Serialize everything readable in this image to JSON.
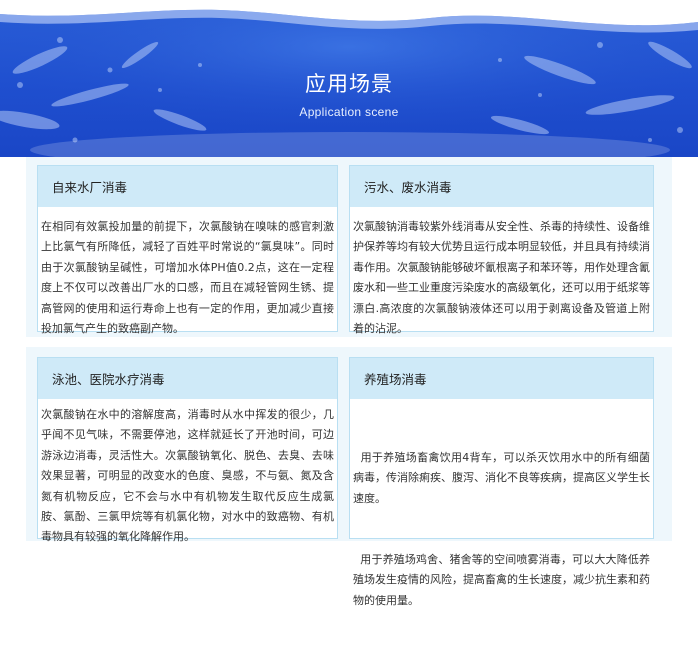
{
  "hero": {
    "title": "应用场景",
    "subtitle": "Application scene"
  },
  "colors": {
    "hero_blue": "#1f4fcf",
    "panel_header": "#cfeaf8",
    "panel_border": "#b9dff2",
    "section_bg": "#eef7fc"
  },
  "panels": [
    {
      "title": "自来水厂消毒",
      "paragraphs": [
        "在相同有效氯投加量的前提下，次氯酸钠在嗅味的感官刺激上比氯气有所降低，减轻了百姓平时常说的“氯臭味”。同时由于次氯酸钠呈碱性，可增加水体PH值0.2点，这在一定程度上不仅可以改善出厂水的口感，而且在减轻管网生锈、提高管网的使用和运行寿命上也有一定的作用，更加减少直接投加氯气产生的致癌副产物。"
      ]
    },
    {
      "title": "污水、废水消毒",
      "paragraphs": [
        "次氯酸钠消毒较紫外线消毒从安全性、杀毒的持续性、设备维护保养等均有较大优势且运行成本明显较低，并且具有持续消毒作用。次氯酸钠能够破坏氰根离子和苯环等，用作处理含氰废水和一些工业重度污染废水的高级氧化，还可以用于纸浆等漂白.高浓度的次氯酸钠液体还可以用于剥离设备及管道上附着的沾泥。"
      ]
    },
    {
      "title": "泳池、医院水疗消毒",
      "paragraphs": [
        "次氯酸钠在水中的溶解度高，消毒时从水中挥发的很少，几乎闻不见气味，不需要停池，这样就延长了开池时间，可边游泳边消毒，灵活性大。次氯酸钠氧化、脱色、去臭、去味效果显著，可明显的改变水的色度、臭感，不与氨、氮及含氮有机物反应，它不会与水中有机物发生取代反应生成氯胺、氯酚、三氯甲烷等有机氯化物，对水中的致癌物、有机毒物具有较强的氧化降解作用。"
      ]
    },
    {
      "title": "养殖场消毒",
      "paragraphs": [
        "  用于养殖场畜禽饮用4背车，可以杀灭饮用水中的所有细菌病毒，传消除痢疾、腹泻、消化不良等疾病，提高区义学生长速度。",
        "  用于养殖场鸡舍、猪舍等的空间喷雾消毒，可以大大降低养殖场发生疫情的风险，提高畜禽的生长速度，减少抗生素和药物的使用量。"
      ]
    }
  ]
}
